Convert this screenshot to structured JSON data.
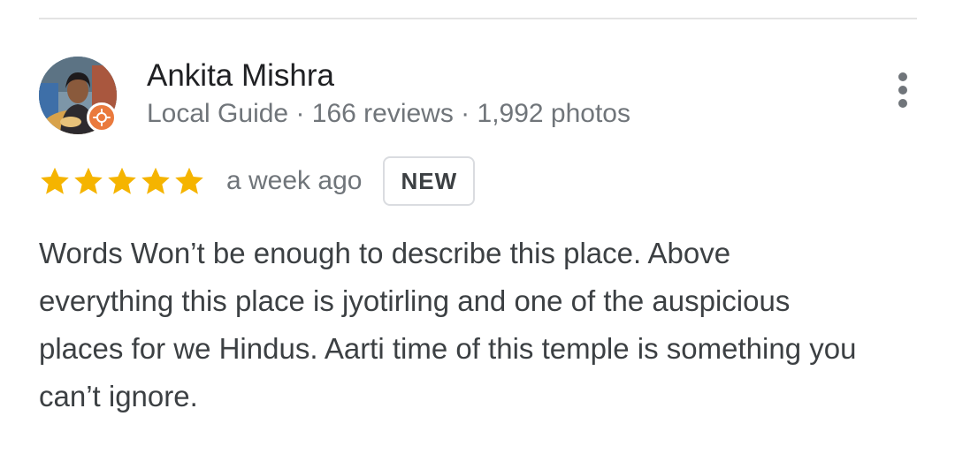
{
  "review": {
    "author": {
      "name": "Ankita Mishra",
      "meta": "Local Guide · 166 reviews · 1,992 photos",
      "badge_color": "#ea7a3d"
    },
    "rating": 5,
    "rating_max": 5,
    "star_color": "#f5b400",
    "date": "a week ago",
    "badge": "NEW",
    "text": "Words Won’t be enough to describe this place. Above everything this place is jyotirling and one of the auspicious places for we Hindus. Aarti time of this temple is something you can’t ignore.",
    "icons": {
      "more": "more-vert-icon",
      "badge": "local-guide-star-icon",
      "rating": "star-icon"
    }
  }
}
